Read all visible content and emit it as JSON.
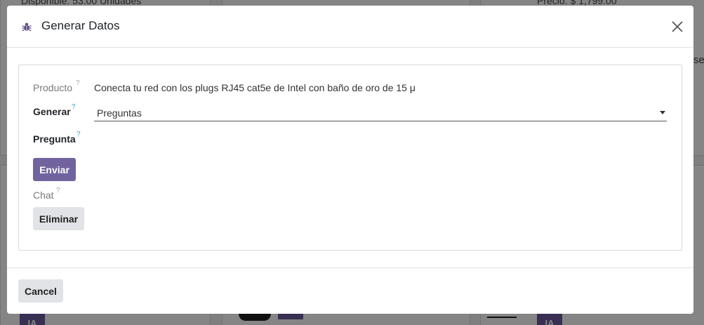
{
  "background": {
    "top_left_text": "Disponible: 53.00 Unidades",
    "top_right_text": "Precio: $ 1,799.00",
    "side_text": "se",
    "ia_badge": "IA"
  },
  "modal": {
    "title": "Generar Datos",
    "fields": {
      "producto": {
        "label": "Producto",
        "help": "?",
        "value": "Conecta tu red con los plugs RJ45 cat5e de Intel con baño de oro de 15 μ"
      },
      "generar": {
        "label": "Generar",
        "help": "?",
        "value": "Preguntas"
      },
      "pregunta": {
        "label": "Pregunta",
        "help": "?"
      },
      "chat": {
        "label": "Chat",
        "help": "?"
      }
    },
    "send_label": "Enviar",
    "delete_label": "Eliminar",
    "cancel_label": "Cancel"
  },
  "colors": {
    "primary": "#71639e",
    "secondary": "#e1e3e6",
    "help": "#3fa4c8"
  }
}
